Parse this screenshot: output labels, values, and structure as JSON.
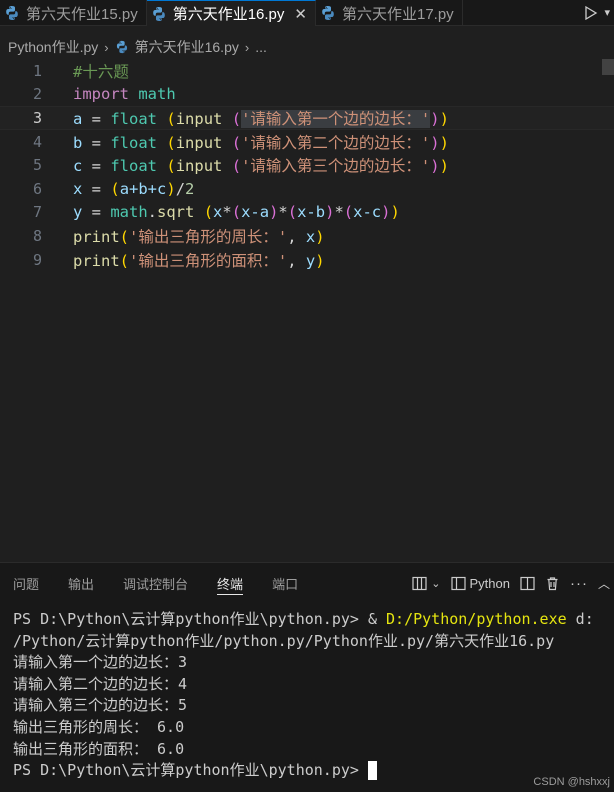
{
  "tabs": [
    {
      "label": "第六天作业15.py",
      "active": false
    },
    {
      "label": "第六天作业16.py",
      "active": true
    },
    {
      "label": "第六天作业17.py",
      "active": false
    }
  ],
  "tab_close_glyph": "✕",
  "breadcrumb": {
    "folder": "Python作业.py",
    "file": "第六天作业16.py",
    "more": "..."
  },
  "editor": {
    "line_numbers": [
      "1",
      "2",
      "3",
      "4",
      "5",
      "6",
      "7",
      "8",
      "9"
    ],
    "current_line": 3,
    "lines": {
      "l1": {
        "comment": "#十六题"
      },
      "l2": {
        "kw": "import",
        "mod": "math"
      },
      "l3": {
        "var": "a",
        "eq": " = ",
        "fn1": "float",
        "sp": " ",
        "p1o": "(",
        "fn2": "input",
        "p2o": "(",
        "str": "'请输入第一个边的边长：'",
        "p2c": ")",
        "p1c": ")"
      },
      "l4": {
        "var": "b",
        "eq": " = ",
        "fn1": "float",
        "sp": " ",
        "p1o": "(",
        "fn2": "input",
        "p2o": "(",
        "str": "'请输入第二个边的边长：'",
        "p2c": ")",
        "p1c": ")"
      },
      "l5": {
        "var": "c",
        "eq": " = ",
        "fn1": "float",
        "sp": " ",
        "p1o": "(",
        "fn2": "input",
        "p2o": "(",
        "str": "'请输入第三个边的边长：'",
        "p2c": ")",
        "p1c": ")"
      },
      "l6": {
        "var": "x",
        "eq": " = ",
        "po": "(",
        "expr": "a+b+c",
        "pc": ")",
        "div": "/",
        "num": "2"
      },
      "l7": {
        "var": "y",
        "eq": " = ",
        "mod": "math",
        "dot": ".",
        "fn": "sqrt",
        "sp": " ",
        "p1o": "(",
        "x": "x",
        "m1": "*",
        "p2o": "(",
        "e1": "x-a",
        "p2c": ")",
        "m2": "*",
        "p3o": "(",
        "e2": "x-b",
        "p3c": ")",
        "m3": "*",
        "p4o": "(",
        "e3": "x-c",
        "p4c": ")",
        "p1c": ")"
      },
      "l8": {
        "fn": "print",
        "po": "(",
        "str": "'输出三角形的周长：'",
        "comma": ", ",
        "arg": "x",
        "pc": ")"
      },
      "l9": {
        "fn": "print",
        "po": "(",
        "str": "'输出三角形的面积：'",
        "comma": ", ",
        "arg": "y",
        "pc": ")"
      }
    }
  },
  "panel": {
    "tabs": [
      "问题",
      "输出",
      "调试控制台",
      "终端",
      "端口"
    ],
    "active_tab": "终端",
    "terminal_profile": "Python"
  },
  "terminal": {
    "prompt1": "PS D:\\Python\\云计算python作业\\python.py> ",
    "cmd_amp": "& ",
    "cmd_exe": "D:/Python/python.exe",
    "cmd_arg_part1": " d:",
    "cmd_arg_part2": "/Python/云计算python作业/python.py/Python作业.py/第六天作业16.py",
    "out1": "请输入第一个边的边长：3",
    "out2": "请输入第二个边的边长：4",
    "out3": "请输入第三个边的边长：5",
    "out4": "输出三角形的周长： 6.0",
    "out5": "输出三角形的面积： 6.0",
    "prompt2": "PS D:\\Python\\云计算python作业\\python.py> "
  },
  "watermark": "CSDN @hshxxj",
  "colors": {
    "background": "#1f1f1f",
    "keyword": "#c586c0",
    "function": "#dcdcaa",
    "builtin": "#4ec9b0",
    "variable": "#9cdcfe",
    "string": "#ce9178",
    "comment": "#6a9955",
    "accent": "#0078d4"
  },
  "icons": {
    "file": "python-file-icon",
    "run": "run-icon",
    "split": "split-editor-icon",
    "trash": "trash-icon",
    "more": "more-icon"
  }
}
